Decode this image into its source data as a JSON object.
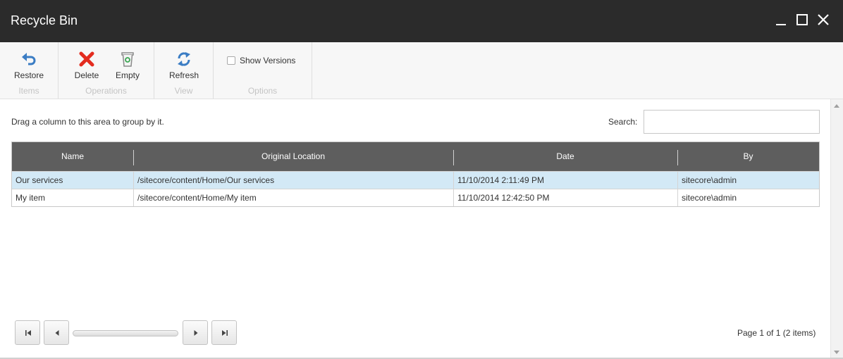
{
  "window": {
    "title": "Recycle Bin"
  },
  "ribbon": {
    "groups": {
      "items": {
        "caption": "Items",
        "restore_label": "Restore"
      },
      "operations": {
        "caption": "Operations",
        "delete_label": "Delete",
        "empty_label": "Empty"
      },
      "view": {
        "caption": "View",
        "refresh_label": "Refresh"
      },
      "options": {
        "caption": "Options",
        "show_versions_label": "Show Versions",
        "show_versions_checked": false
      }
    }
  },
  "grouping_hint": "Drag a column to this area to group by it.",
  "search": {
    "label": "Search:",
    "value": "",
    "placeholder": ""
  },
  "grid": {
    "columns": [
      "Name",
      "Original Location",
      "Date",
      "By"
    ],
    "rows": [
      {
        "name": "Our services",
        "location": "/sitecore/content/Home/Our services",
        "date": "11/10/2014 2:11:49 PM",
        "by": "sitecore\\admin",
        "selected": true
      },
      {
        "name": "My item",
        "location": "/sitecore/content/Home/My item",
        "date": "11/10/2014 12:42:50 PM",
        "by": "sitecore\\admin",
        "selected": false
      }
    ]
  },
  "pager": {
    "info": "Page 1 of 1 (2 items)"
  },
  "colors": {
    "titlebar": "#2b2b2b",
    "grid_header": "#5e5e5e",
    "selected_row": "#d3e9f6",
    "delete_red": "#e32c1f",
    "restore_blue": "#3b7dc4",
    "empty_green": "#3aa652"
  },
  "icons": {
    "restore": "undo-arrow-icon",
    "delete": "red-x-icon",
    "empty": "trash-can-icon",
    "refresh": "refresh-arrows-icon"
  }
}
